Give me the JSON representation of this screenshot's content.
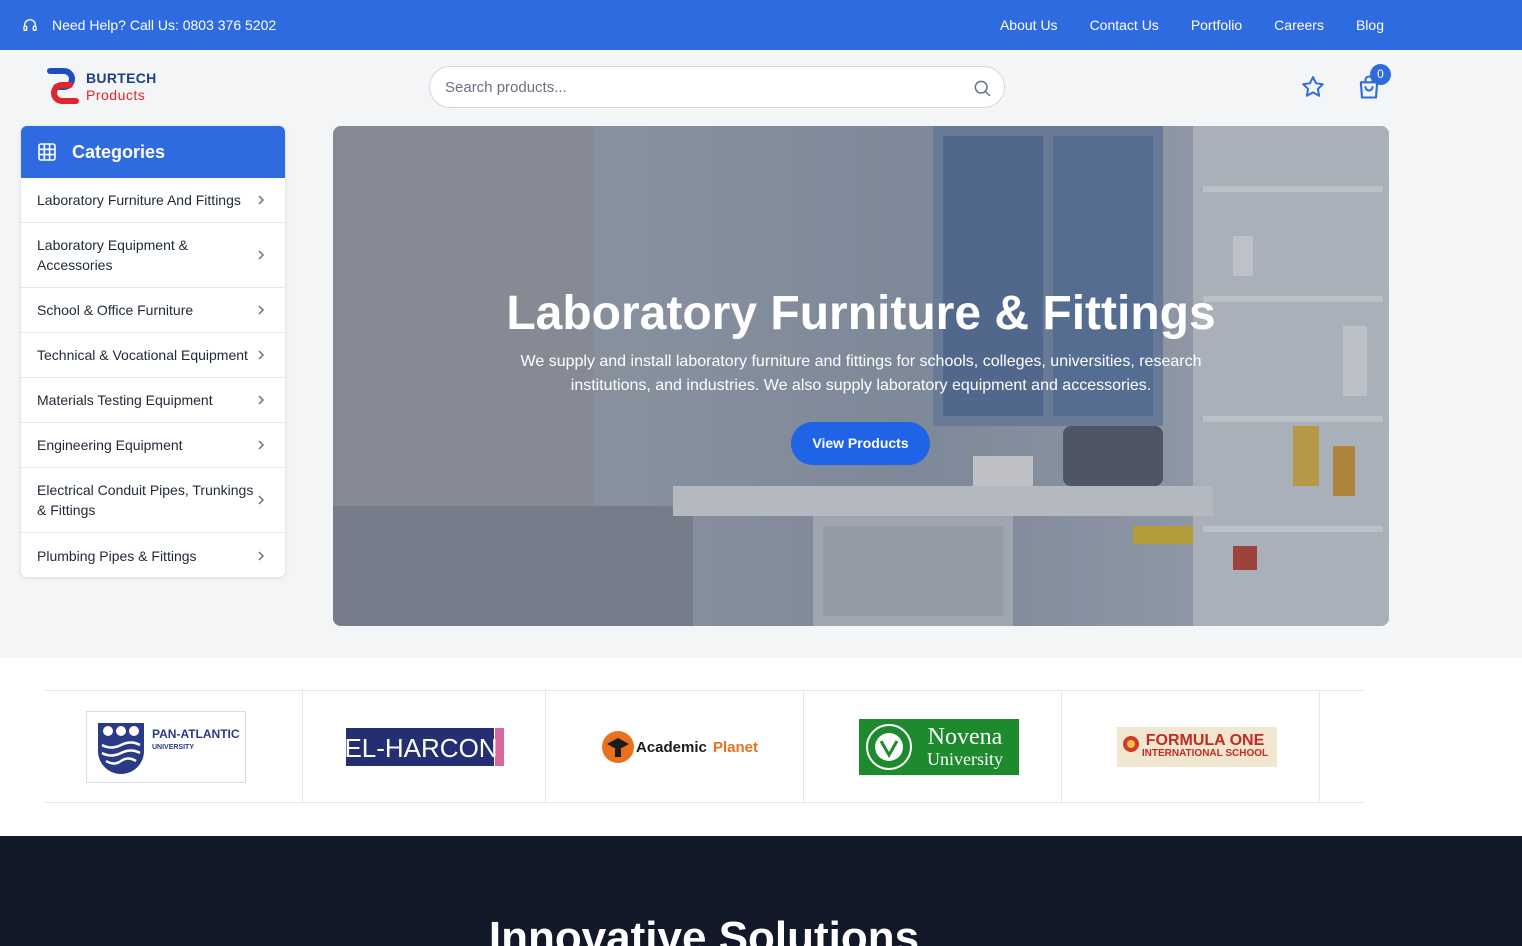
{
  "topbar": {
    "help_text": "Need Help? Call Us: 0803 376 5202",
    "nav": [
      "About Us",
      "Contact Us",
      "Portfolio",
      "Careers",
      "Blog"
    ]
  },
  "logo": {
    "line1": "BURTECH",
    "line2": "Products"
  },
  "search": {
    "placeholder": "Search products..."
  },
  "cart": {
    "count": "0"
  },
  "categories": {
    "title": "Categories",
    "items": [
      "Laboratory Furniture And Fittings",
      "Laboratory Equipment & Accessories",
      "School & Office Furniture",
      "Technical & Vocational Equipment",
      "Materials Testing Equipment",
      "Engineering Equipment",
      "Electrical Conduit Pipes, Trunkings & Fittings",
      "Plumbing Pipes & Fittings"
    ]
  },
  "hero": {
    "title": "Laboratory Furniture & Fittings",
    "text": "We supply and install laboratory furniture and fittings for schools, colleges, universities, research institutions, and industries. We also supply laboratory equipment and accessories.",
    "button": "View Products"
  },
  "partners": [
    {
      "name": "PAN-ATLANTIC",
      "sub": "UNIVERSITY"
    },
    {
      "name": "EL-HARCON"
    },
    {
      "name": "Academic",
      "name2": "Planet"
    },
    {
      "name": "Novena",
      "name2": "University"
    },
    {
      "name": "FORMULA ONE",
      "sub": "INTERNATIONAL SCHOOL"
    }
  ],
  "section": {
    "title": "Innovative Solutions"
  },
  "colors": {
    "primary": "#2e6ae0",
    "dark": "#111827",
    "accent_red": "#e0262b"
  }
}
